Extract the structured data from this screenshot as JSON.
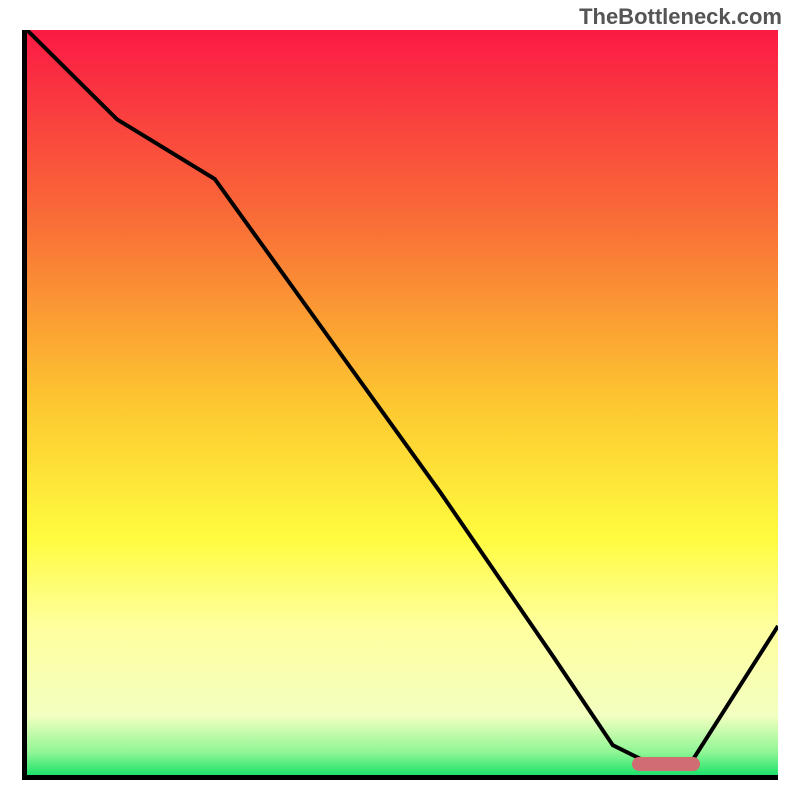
{
  "watermark": "TheBottleneck.com",
  "chart_data": {
    "type": "line",
    "title": "",
    "xlabel": "",
    "ylabel": "",
    "xlim": [
      0,
      100
    ],
    "ylim": [
      0,
      100
    ],
    "series": [
      {
        "name": "bottleneck-curve",
        "x": [
          0,
          12,
          25,
          40,
          55,
          70,
          78,
          84,
          88,
          100
        ],
        "values": [
          100,
          88,
          80,
          59,
          38,
          16,
          4,
          1,
          1,
          20
        ]
      }
    ],
    "optimal_marker": {
      "x_start": 80,
      "x_end": 89,
      "color": "#d16d72"
    },
    "gradient_stops": [
      {
        "offset": 0,
        "color": "#fb1a45"
      },
      {
        "offset": 25,
        "color": "#f96b37"
      },
      {
        "offset": 50,
        "color": "#fdc730"
      },
      {
        "offset": 68,
        "color": "#fffb3e"
      },
      {
        "offset": 80,
        "color": "#ffff9e"
      },
      {
        "offset": 92,
        "color": "#f3ffc0"
      },
      {
        "offset": 97,
        "color": "#8ef694"
      },
      {
        "offset": 100,
        "color": "#1ee26b"
      }
    ]
  }
}
